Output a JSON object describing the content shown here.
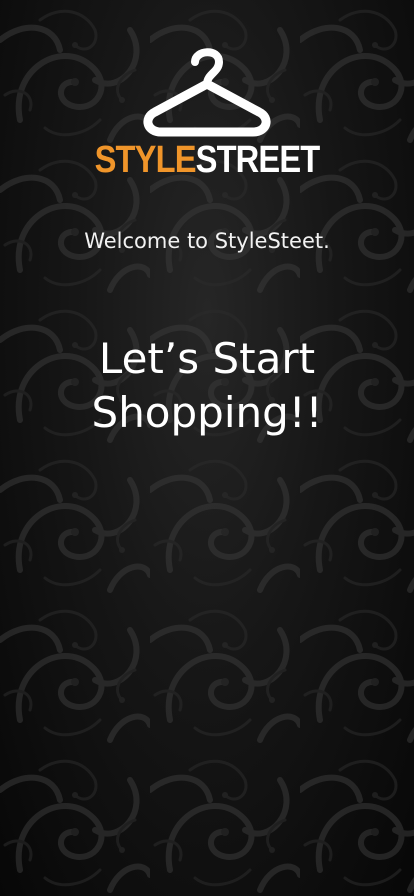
{
  "brand": {
    "part1": "STYLE",
    "part2": "STREET",
    "accent_color": "#f0952a",
    "logo_icon": "hanger-icon"
  },
  "welcome_text": "Welcome to StyleSteet.",
  "headline": {
    "line1": "Let’s Start",
    "line2": "Shopping!!"
  },
  "colors": {
    "background": "#111111",
    "text": "#ffffff"
  }
}
